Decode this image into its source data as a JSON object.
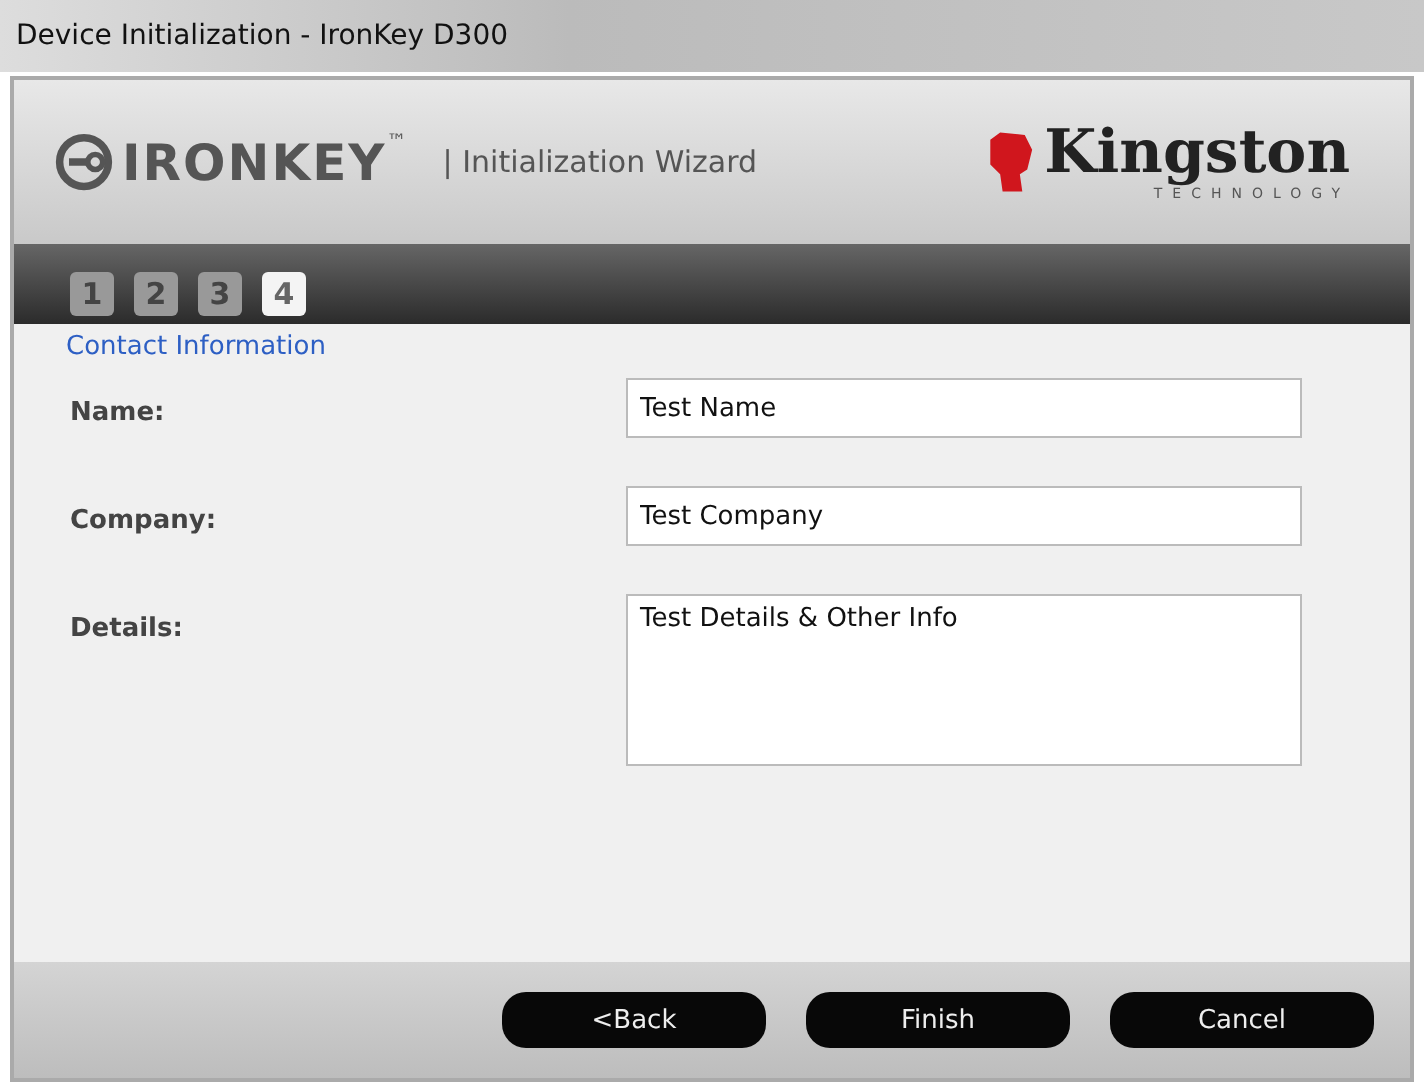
{
  "window": {
    "title": "Device Initialization - IronKey D300"
  },
  "header": {
    "brand": "IRONKEY",
    "trademark": "™",
    "subtitle": "| Initialization Wizard",
    "vendor": "Kingston",
    "vendor_tagline": "TECHNOLOGY"
  },
  "steps": [
    {
      "label": "1",
      "selected": false
    },
    {
      "label": "2",
      "selected": false
    },
    {
      "label": "3",
      "selected": false
    },
    {
      "label": "4",
      "selected": true
    }
  ],
  "section_title": "Contact Information",
  "fields": [
    {
      "label": "Name:",
      "value": "Test Name",
      "kind": "line"
    },
    {
      "label": "Company:",
      "value": "Test Company",
      "kind": "line"
    },
    {
      "label": "Details:",
      "value": "Test Details & Other Info",
      "kind": "area"
    }
  ],
  "buttons": [
    "<Back",
    "Finish",
    "Cancel"
  ]
}
